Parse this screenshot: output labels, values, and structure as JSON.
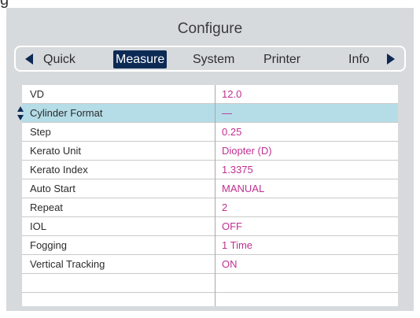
{
  "corner_text": "g",
  "title": "Configure",
  "tabs": [
    {
      "label": "Quick",
      "active": false
    },
    {
      "label": "Measure",
      "active": true
    },
    {
      "label": "System",
      "active": false
    },
    {
      "label": "Printer",
      "active": false
    },
    {
      "label": "Info",
      "active": false
    }
  ],
  "rows": [
    {
      "label": "VD",
      "value": "12.0"
    },
    {
      "label": "Cylinder Format",
      "value": "—"
    },
    {
      "label": "Step",
      "value": "0.25"
    },
    {
      "label": "Kerato Unit",
      "value": "Diopter (D)"
    },
    {
      "label": "Kerato Index",
      "value": "1.3375"
    },
    {
      "label": "Auto Start",
      "value": "MANUAL"
    },
    {
      "label": "Repeat",
      "value": "2"
    },
    {
      "label": "IOL",
      "value": "OFF"
    },
    {
      "label": "Fogging",
      "value": "1 Time"
    },
    {
      "label": "Vertical Tracking",
      "value": "ON"
    },
    {
      "label": "",
      "value": ""
    }
  ],
  "selected_row": 1,
  "colors": {
    "accent": "#0d2a55",
    "value_text": "#c03090",
    "selected_row": "#b5dde8",
    "panel_bg": "#d7dadd"
  },
  "icons": {
    "tab_prev": "arrow-left-icon",
    "tab_next": "arrow-right-icon",
    "row_adjust": "up-down-icon"
  }
}
